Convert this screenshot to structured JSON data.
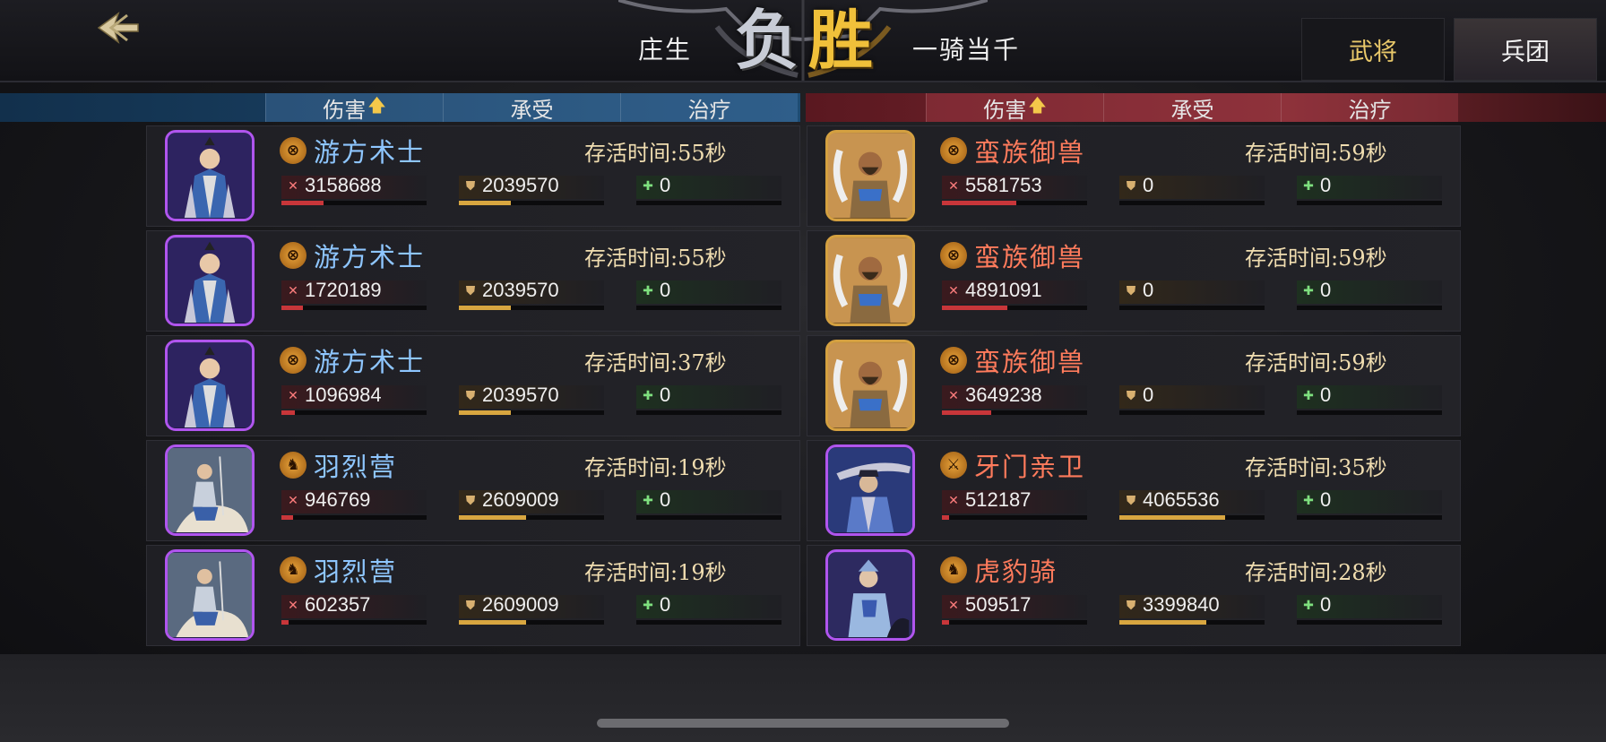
{
  "top_bar": {
    "left_player": "庄生",
    "right_player": "一骑当千",
    "lose_label": "负",
    "win_label": "胜",
    "tabs": [
      {
        "label": "武将",
        "active": false
      },
      {
        "label": "兵团",
        "active": true
      }
    ]
  },
  "headers": {
    "left": [
      "伤害",
      "承受",
      "治疗"
    ],
    "right": [
      "伤害",
      "承受",
      "治疗"
    ],
    "sort_arrow": "🡅"
  },
  "left_units": [
    {
      "name": "游方术士",
      "survive": "存活时间:55秒",
      "damage": "3158688",
      "taken": "2039570",
      "heal": "0",
      "damage_frac": 0.29,
      "taken_frac": 0.36,
      "heal_frac": 0.0,
      "type_icon": "bow-icon",
      "portrait": "mage"
    },
    {
      "name": "游方术士",
      "survive": "存活时间:55秒",
      "damage": "1720189",
      "taken": "2039570",
      "heal": "0",
      "damage_frac": 0.15,
      "taken_frac": 0.36,
      "heal_frac": 0.0,
      "type_icon": "bow-icon",
      "portrait": "mage"
    },
    {
      "name": "游方术士",
      "survive": "存活时间:37秒",
      "damage": "1096984",
      "taken": "2039570",
      "heal": "0",
      "damage_frac": 0.09,
      "taken_frac": 0.36,
      "heal_frac": 0.0,
      "type_icon": "bow-icon",
      "portrait": "mage"
    },
    {
      "name": "羽烈营",
      "survive": "存活时间:19秒",
      "damage": "946769",
      "taken": "2609009",
      "heal": "0",
      "damage_frac": 0.08,
      "taken_frac": 0.46,
      "heal_frac": 0.0,
      "type_icon": "horse-icon",
      "portrait": "rider"
    },
    {
      "name": "羽烈营",
      "survive": "存活时间:19秒",
      "damage": "602357",
      "taken": "2609009",
      "heal": "0",
      "damage_frac": 0.05,
      "taken_frac": 0.46,
      "heal_frac": 0.0,
      "type_icon": "horse-icon",
      "portrait": "rider"
    }
  ],
  "right_units": [
    {
      "name": "蛮族御兽",
      "survive": "存活时间:59秒",
      "damage": "5581753",
      "taken": "0",
      "heal": "0",
      "damage_frac": 0.51,
      "taken_frac": 0.0,
      "heal_frac": 0.0,
      "type_icon": "bow-icon",
      "portrait": "beast",
      "frame": "gold"
    },
    {
      "name": "蛮族御兽",
      "survive": "存活时间:59秒",
      "damage": "4891091",
      "taken": "0",
      "heal": "0",
      "damage_frac": 0.45,
      "taken_frac": 0.0,
      "heal_frac": 0.0,
      "type_icon": "bow-icon",
      "portrait": "beast",
      "frame": "gold"
    },
    {
      "name": "蛮族御兽",
      "survive": "存活时间:59秒",
      "damage": "3649238",
      "taken": "0",
      "heal": "0",
      "damage_frac": 0.34,
      "taken_frac": 0.0,
      "heal_frac": 0.0,
      "type_icon": "bow-icon",
      "portrait": "beast",
      "frame": "gold"
    },
    {
      "name": "牙门亲卫",
      "survive": "存活时间:35秒",
      "damage": "512187",
      "taken": "4065536",
      "heal": "0",
      "damage_frac": 0.05,
      "taken_frac": 0.73,
      "heal_frac": 0.0,
      "type_icon": "sword-icon",
      "portrait": "guard",
      "frame": "purple"
    },
    {
      "name": "虎豹骑",
      "survive": "存活时间:28秒",
      "damage": "509517",
      "taken": "3399840",
      "heal": "0",
      "damage_frac": 0.05,
      "taken_frac": 0.6,
      "heal_frac": 0.0,
      "type_icon": "horse-icon",
      "portrait": "knight",
      "frame": "purple"
    }
  ],
  "icons": {
    "damage": "✕",
    "taken": "⛊",
    "heal": "✚",
    "bow": "⊗",
    "horse": "♞",
    "sword": "⚔"
  }
}
